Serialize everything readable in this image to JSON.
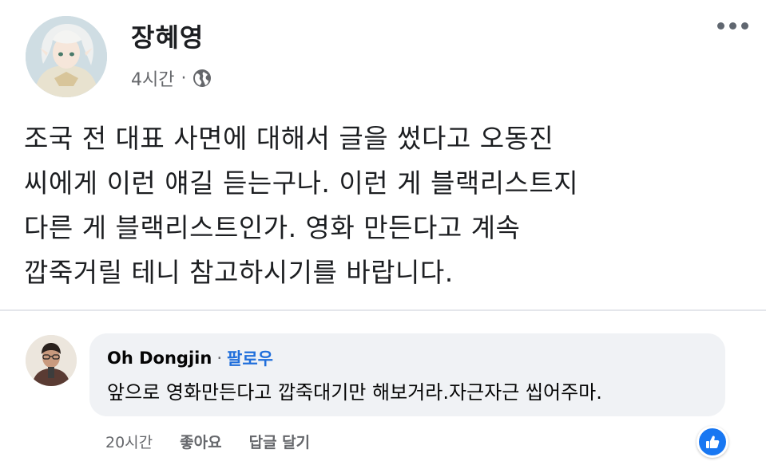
{
  "post": {
    "author": "장혜영",
    "time": "4시간",
    "meta_separator": "·",
    "audience_icon": "globe-icon",
    "body_lines": [
      "조국 전 대표 사면에 대해서 글을 썼다고 오동진",
      "씨에게 이런 얘길 듣는구나. 이런 게 블랙리스트지",
      "다른 게 블랙리스트인가. 영화 만든다고 계속",
      "깝죽거릴 테니 참고하시기를 바랍니다."
    ]
  },
  "comment": {
    "author": "Oh Dongjin",
    "separator": "·",
    "follow_label": "팔로우",
    "text": "앞으로 영화만든다고 깝죽대기만 해보거라.자근자근 씹어주마.",
    "time": "20시간",
    "like_label": "좋아요",
    "reply_label": "답글 달기",
    "reaction_icon": "thumbs-up-icon"
  },
  "colors": {
    "link": "#216fdb",
    "reaction": "#1877f2",
    "bubble": "#f0f2f5",
    "secondary_text": "#65676b"
  }
}
